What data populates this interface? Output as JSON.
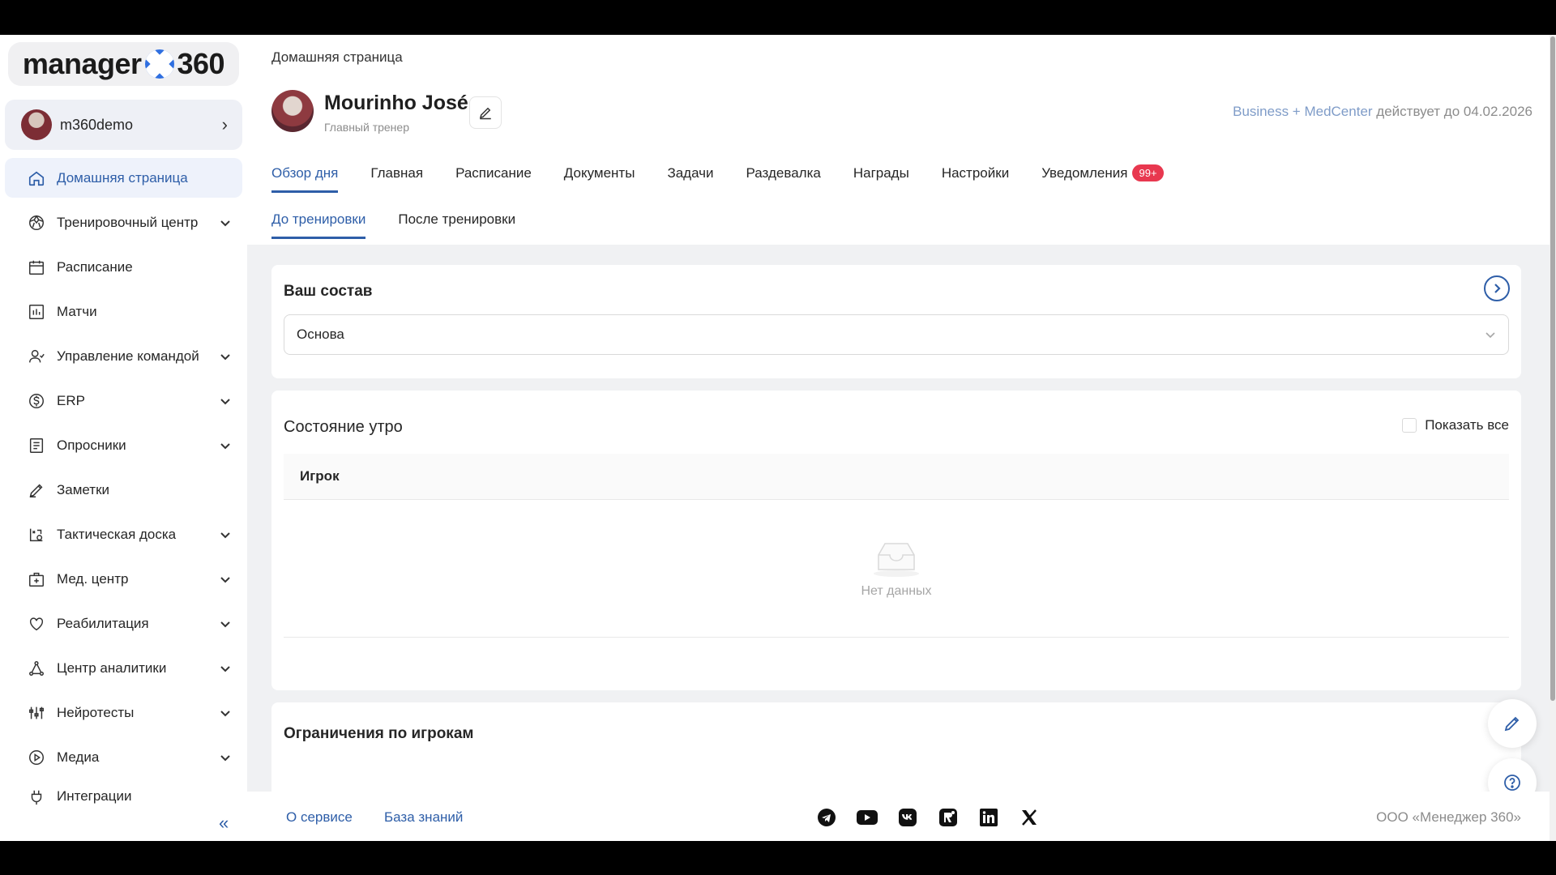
{
  "brand": {
    "text_left": "manager",
    "text_right": "360"
  },
  "user": {
    "name": "m360demo"
  },
  "sidebar": {
    "items": [
      {
        "label": "Домашняя страница",
        "icon": "home-icon",
        "has_caret": false,
        "active": true
      },
      {
        "label": "Тренировочный центр",
        "icon": "ball-icon",
        "has_caret": true
      },
      {
        "label": "Расписание",
        "icon": "calendar-icon",
        "has_caret": false
      },
      {
        "label": "Матчи",
        "icon": "chart-icon",
        "has_caret": false
      },
      {
        "label": "Управление командой",
        "icon": "team-icon",
        "has_caret": true
      },
      {
        "label": "ERP",
        "icon": "dollar-icon",
        "has_caret": true
      },
      {
        "label": "Опросники",
        "icon": "clipboard-icon",
        "has_caret": true
      },
      {
        "label": "Заметки",
        "icon": "pen-icon",
        "has_caret": false
      },
      {
        "label": "Тактическая доска",
        "icon": "tactics-icon",
        "has_caret": true
      },
      {
        "label": "Мед. центр",
        "icon": "medkit-icon",
        "has_caret": true
      },
      {
        "label": "Реабилитация",
        "icon": "heart-icon",
        "has_caret": true
      },
      {
        "label": "Центр аналитики",
        "icon": "analytics-icon",
        "has_caret": true
      },
      {
        "label": "Нейротесты",
        "icon": "sliders-icon",
        "has_caret": true
      },
      {
        "label": "Медиа",
        "icon": "play-icon",
        "has_caret": true
      },
      {
        "label": "Интеграции",
        "icon": "plug-icon",
        "has_caret": false
      }
    ],
    "collapse_label": "«"
  },
  "header": {
    "breadcrumb": "Домашняя страница",
    "profile_name": "Mourinho José",
    "profile_role": "Главный тренер",
    "license_plan": "Business + MedCenter",
    "license_text": " действует до 04.02.2026"
  },
  "tabs": [
    {
      "label": "Обзор дня",
      "active": true
    },
    {
      "label": "Главная"
    },
    {
      "label": "Расписание"
    },
    {
      "label": "Документы"
    },
    {
      "label": "Задачи"
    },
    {
      "label": "Раздевалка"
    },
    {
      "label": "Награды"
    },
    {
      "label": "Настройки"
    },
    {
      "label": "Уведомления",
      "badge": "99+"
    }
  ],
  "subtabs": [
    {
      "label": "До тренировки",
      "active": true
    },
    {
      "label": "После тренировки"
    }
  ],
  "squad_card": {
    "title": "Ваш состав",
    "select_value": "Основа"
  },
  "morning_card": {
    "title": "Состояние утро",
    "show_all_label": "Показать все",
    "show_all_checked": false,
    "column_header": "Игрок",
    "empty_text": "Нет данных"
  },
  "restrictions_card": {
    "title": "Ограничения по игрокам"
  },
  "footer": {
    "about": "О сервисе",
    "knowledge": "База знаний",
    "copyright": "ООО «Менеджер 360»",
    "social": [
      "telegram-icon",
      "youtube-icon",
      "vk-icon",
      "rutube-icon",
      "linkedin-icon",
      "x-icon"
    ]
  },
  "colors": {
    "accent": "#2e5ea8",
    "badge": "#e8384f",
    "active_bg": "#eef2fb"
  }
}
